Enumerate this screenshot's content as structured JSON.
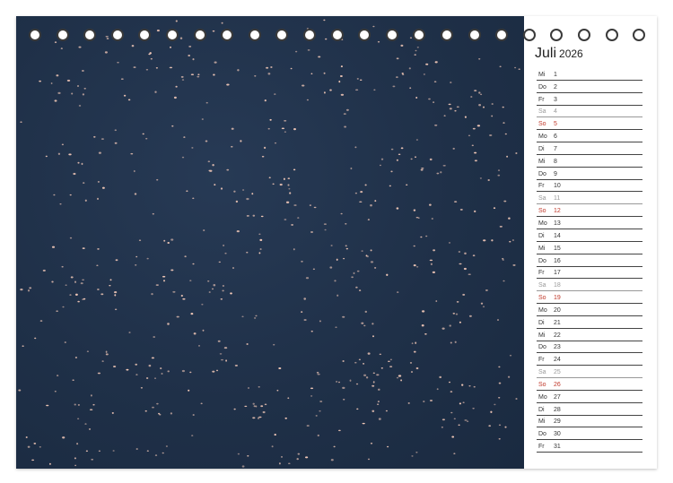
{
  "calendar": {
    "month": "Juli",
    "year": "2026",
    "days": [
      {
        "weekday": "Mi",
        "day": "1",
        "type": "weekday"
      },
      {
        "weekday": "Do",
        "day": "2",
        "type": "weekday"
      },
      {
        "weekday": "Fr",
        "day": "3",
        "type": "weekday"
      },
      {
        "weekday": "Sa",
        "day": "4",
        "type": "saturday"
      },
      {
        "weekday": "So",
        "day": "5",
        "type": "sunday"
      },
      {
        "weekday": "Mo",
        "day": "6",
        "type": "weekday"
      },
      {
        "weekday": "Di",
        "day": "7",
        "type": "weekday"
      },
      {
        "weekday": "Mi",
        "day": "8",
        "type": "weekday"
      },
      {
        "weekday": "Do",
        "day": "9",
        "type": "weekday"
      },
      {
        "weekday": "Fr",
        "day": "10",
        "type": "weekday"
      },
      {
        "weekday": "Sa",
        "day": "11",
        "type": "saturday"
      },
      {
        "weekday": "So",
        "day": "12",
        "type": "sunday"
      },
      {
        "weekday": "Mo",
        "day": "13",
        "type": "weekday"
      },
      {
        "weekday": "Di",
        "day": "14",
        "type": "weekday"
      },
      {
        "weekday": "Mi",
        "day": "15",
        "type": "weekday"
      },
      {
        "weekday": "Do",
        "day": "16",
        "type": "weekday"
      },
      {
        "weekday": "Fr",
        "day": "17",
        "type": "weekday"
      },
      {
        "weekday": "Sa",
        "day": "18",
        "type": "saturday"
      },
      {
        "weekday": "So",
        "day": "19",
        "type": "sunday"
      },
      {
        "weekday": "Mo",
        "day": "20",
        "type": "weekday"
      },
      {
        "weekday": "Di",
        "day": "21",
        "type": "weekday"
      },
      {
        "weekday": "Mi",
        "day": "22",
        "type": "weekday"
      },
      {
        "weekday": "Do",
        "day": "23",
        "type": "weekday"
      },
      {
        "weekday": "Fr",
        "day": "24",
        "type": "weekday"
      },
      {
        "weekday": "Sa",
        "day": "25",
        "type": "saturday"
      },
      {
        "weekday": "So",
        "day": "26",
        "type": "sunday"
      },
      {
        "weekday": "Mo",
        "day": "27",
        "type": "weekday"
      },
      {
        "weekday": "Di",
        "day": "28",
        "type": "weekday"
      },
      {
        "weekday": "Mi",
        "day": "29",
        "type": "weekday"
      },
      {
        "weekday": "Do",
        "day": "30",
        "type": "weekday"
      },
      {
        "weekday": "Fr",
        "day": "31",
        "type": "weekday"
      }
    ]
  },
  "colors": {
    "water": "#1f3048",
    "bird": "#f3c9b8",
    "sunday": "#c0392b",
    "saturday": "#9a9a9a"
  },
  "photo": {
    "icon": "flamingo-flock-aerial-photo"
  }
}
